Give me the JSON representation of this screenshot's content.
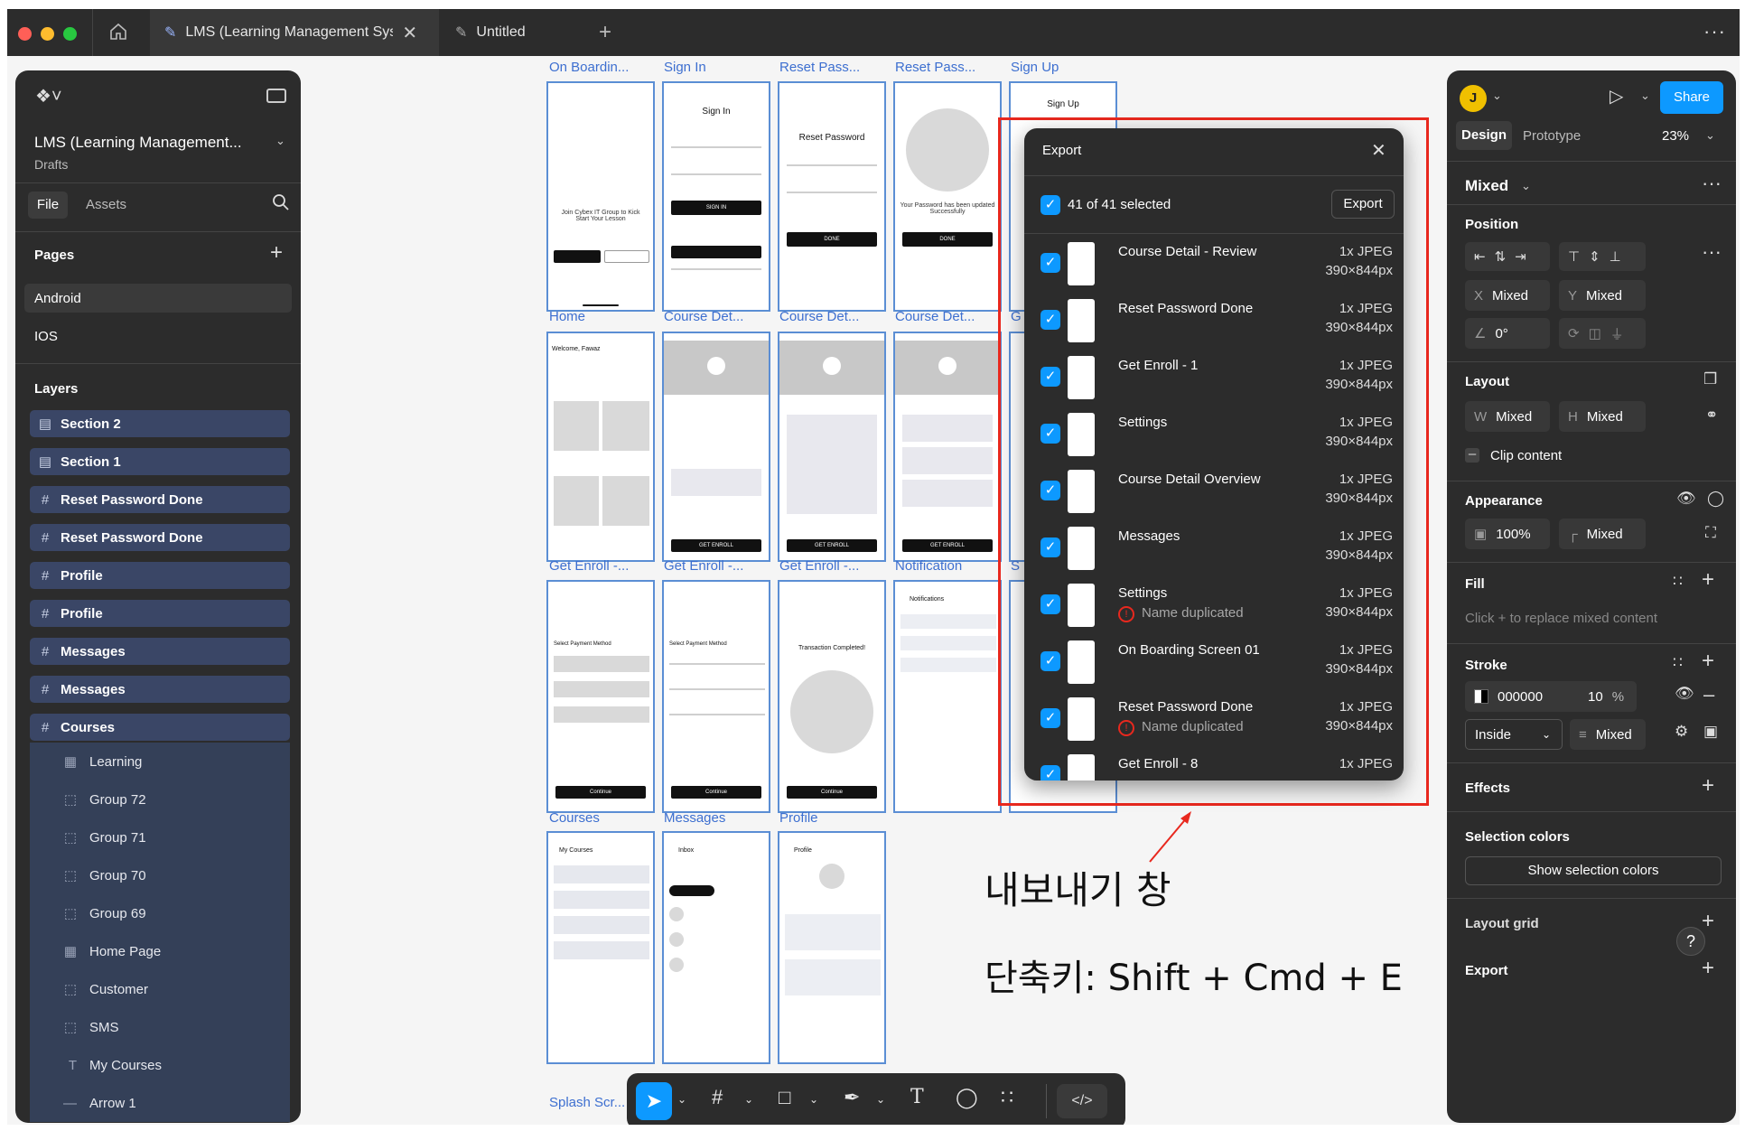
{
  "tabs": {
    "home_icon": "home-icon",
    "active_title": "LMS (Learning Management Syst",
    "untitled": "Untitled",
    "more": "···"
  },
  "left": {
    "project_title": "LMS (Learning Management...",
    "project_sub": "Drafts",
    "tab_file": "File",
    "tab_assets": "Assets",
    "pages_label": "Pages",
    "pages": [
      "Android",
      "IOS"
    ],
    "layers_label": "Layers",
    "layers": [
      {
        "label": "Section 2",
        "icon": "section-icon"
      },
      {
        "label": "Section 1",
        "icon": "section-icon"
      },
      {
        "label": "Reset Password Done",
        "icon": "frame-icon"
      },
      {
        "label": "Reset Password Done",
        "icon": "frame-icon"
      },
      {
        "label": "Profile",
        "icon": "frame-icon"
      },
      {
        "label": "Profile",
        "icon": "frame-icon"
      },
      {
        "label": "Messages",
        "icon": "frame-icon"
      },
      {
        "label": "Messages",
        "icon": "frame-icon"
      },
      {
        "label": "Courses",
        "icon": "frame-icon"
      }
    ],
    "children": [
      "Learning",
      "Group 72",
      "Group 71",
      "Group 70",
      "Group 69",
      "Home Page",
      "Customer",
      "SMS",
      "My Courses",
      "Arrow 1"
    ]
  },
  "canvas": {
    "top_labels": [
      "On Boardin...",
      "Sign In",
      "Reset Pass...",
      "Reset Pass...",
      "Sign Up"
    ],
    "row2_labels": [
      "Home",
      "Course Det...",
      "Course Det...",
      "Course Det...",
      "G"
    ],
    "row3_labels": [
      "Get Enroll -...",
      "Get Enroll -...",
      "Get Enroll -...",
      "Notification",
      "S"
    ],
    "row4_labels": [
      "Courses",
      "Messages",
      "Profile"
    ],
    "bottom_label": "Splash Scr...",
    "onboard_text": "Join Cybex IT Group to Kick Start Your Lesson",
    "signin_title": "Sign In",
    "reset_title": "Reset Password",
    "signup_title": "Sign Up",
    "reset_done_text": "Your Password has been updated Successfully",
    "transaction_text": "Transaction Completed!",
    "welcome_text": "Welcome, Fawaz",
    "notif_title": "Notifications",
    "mycourses_title": "My Courses",
    "inbox_title": "Inbox",
    "profile_title": "Profile",
    "pay_title": "Select Payment Method",
    "btn_signin": "SIGN IN",
    "btn_done": "DONE",
    "btn_enroll": "GET ENROLL",
    "btn_continue": "Continue"
  },
  "dialog": {
    "title": "Export",
    "selected": "41 of 41 selected",
    "export_button": "Export",
    "rows": [
      {
        "name": "Course Detail - Review",
        "fmt": "1x JPEG",
        "size": "390×844px",
        "warn": ""
      },
      {
        "name": "Reset Password Done",
        "fmt": "1x JPEG",
        "size": "390×844px",
        "warn": ""
      },
      {
        "name": "Get Enroll - 1",
        "fmt": "1x JPEG",
        "size": "390×844px",
        "warn": ""
      },
      {
        "name": "Settings",
        "fmt": "1x JPEG",
        "size": "390×844px",
        "warn": ""
      },
      {
        "name": "Course Detail Overview",
        "fmt": "1x JPEG",
        "size": "390×844px",
        "warn": ""
      },
      {
        "name": "Messages",
        "fmt": "1x JPEG",
        "size": "390×844px",
        "warn": ""
      },
      {
        "name": "Settings",
        "fmt": "1x JPEG",
        "size": "390×844px",
        "warn": "Name duplicated"
      },
      {
        "name": "On Boarding Screen 01",
        "fmt": "1x JPEG",
        "size": "390×844px",
        "warn": ""
      },
      {
        "name": "Reset Password Done",
        "fmt": "1x JPEG",
        "size": "390×844px",
        "warn": "Name duplicated"
      },
      {
        "name": "Get Enroll - 8",
        "fmt": "1x JPEG",
        "size": "",
        "warn": ""
      }
    ]
  },
  "annotation": {
    "line1": "내보내기 창",
    "line2": "단축키: Shift + Cmd + E",
    "color": "#e8281e"
  },
  "right": {
    "avatar": "J",
    "share": "Share",
    "tab_design": "Design",
    "tab_prototype": "Prototype",
    "zoom": "23%",
    "mixed_header": "Mixed",
    "position_label": "Position",
    "x_label": "X",
    "x_value": "Mixed",
    "y_label": "Y",
    "y_value": "Mixed",
    "rotation": "0°",
    "layout_label": "Layout",
    "w_label": "W",
    "w_value": "Mixed",
    "h_label": "H",
    "h_value": "Mixed",
    "clip": "Clip content",
    "appearance_label": "Appearance",
    "opacity": "100%",
    "radius": "Mixed",
    "fill_label": "Fill",
    "fill_hint": "Click + to replace mixed content",
    "stroke_label": "Stroke",
    "stroke_color": "000000",
    "stroke_opacity": "10",
    "stroke_pct": "%",
    "stroke_pos": "Inside",
    "stroke_weight": "Mixed",
    "effects_label": "Effects",
    "selection_colors_label": "Selection colors",
    "show_colors": "Show selection colors",
    "layout_grid_label": "Layout grid",
    "export_label": "Export",
    "help": "?",
    "accent": "#0d99ff"
  }
}
